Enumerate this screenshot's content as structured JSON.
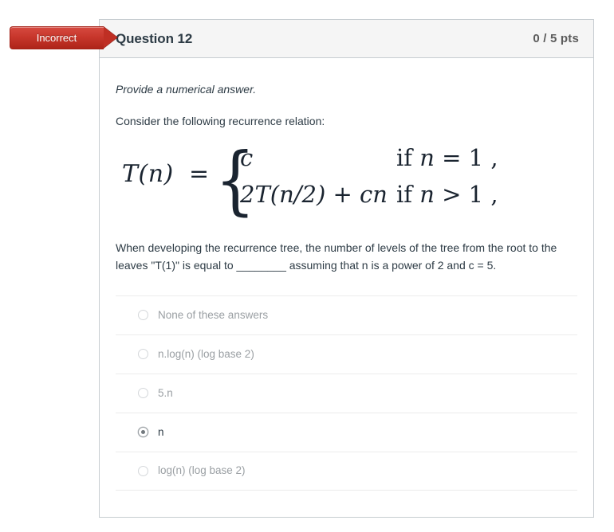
{
  "status_banner": {
    "label": "Incorrect",
    "color": "#c8372c"
  },
  "question": {
    "title": "Question 12",
    "points": "0 / 5 pts",
    "instruction": "Provide a numerical answer.",
    "intro": "Consider the following recurrence relation:",
    "formula": {
      "lhs": "T(n)",
      "equals": "=",
      "brace": "{",
      "cases": [
        {
          "expression": "c",
          "condition_prefix": "if ",
          "condition": "n = 1",
          "trailing": ","
        },
        {
          "expression": "2T(n/2) + cn",
          "condition_prefix": "if ",
          "condition": "n > 1",
          "trailing": ","
        }
      ],
      "case1_expr_italic": "c",
      "case2_expr": "2T(n/2) + cn",
      "case1_cond_if": "if",
      "case1_cond_var": "n",
      "case1_cond_rest": "= 1 ,",
      "case2_cond_if": "if",
      "case2_cond_var": "n",
      "case2_cond_rest": "> 1 ,"
    },
    "statement": "When developing the recurrence tree, the number of levels of the tree from the root to the leaves \"T(1)\" is equal to ________ assuming that n is a power of 2 and c = 5.",
    "answers": [
      {
        "label": "None of these answers",
        "selected": false
      },
      {
        "label": "n.log(n) (log base 2)",
        "selected": false
      },
      {
        "label": "5.n",
        "selected": false
      },
      {
        "label": "n",
        "selected": true
      },
      {
        "label": "log(n) (log base 2)",
        "selected": false
      }
    ]
  }
}
